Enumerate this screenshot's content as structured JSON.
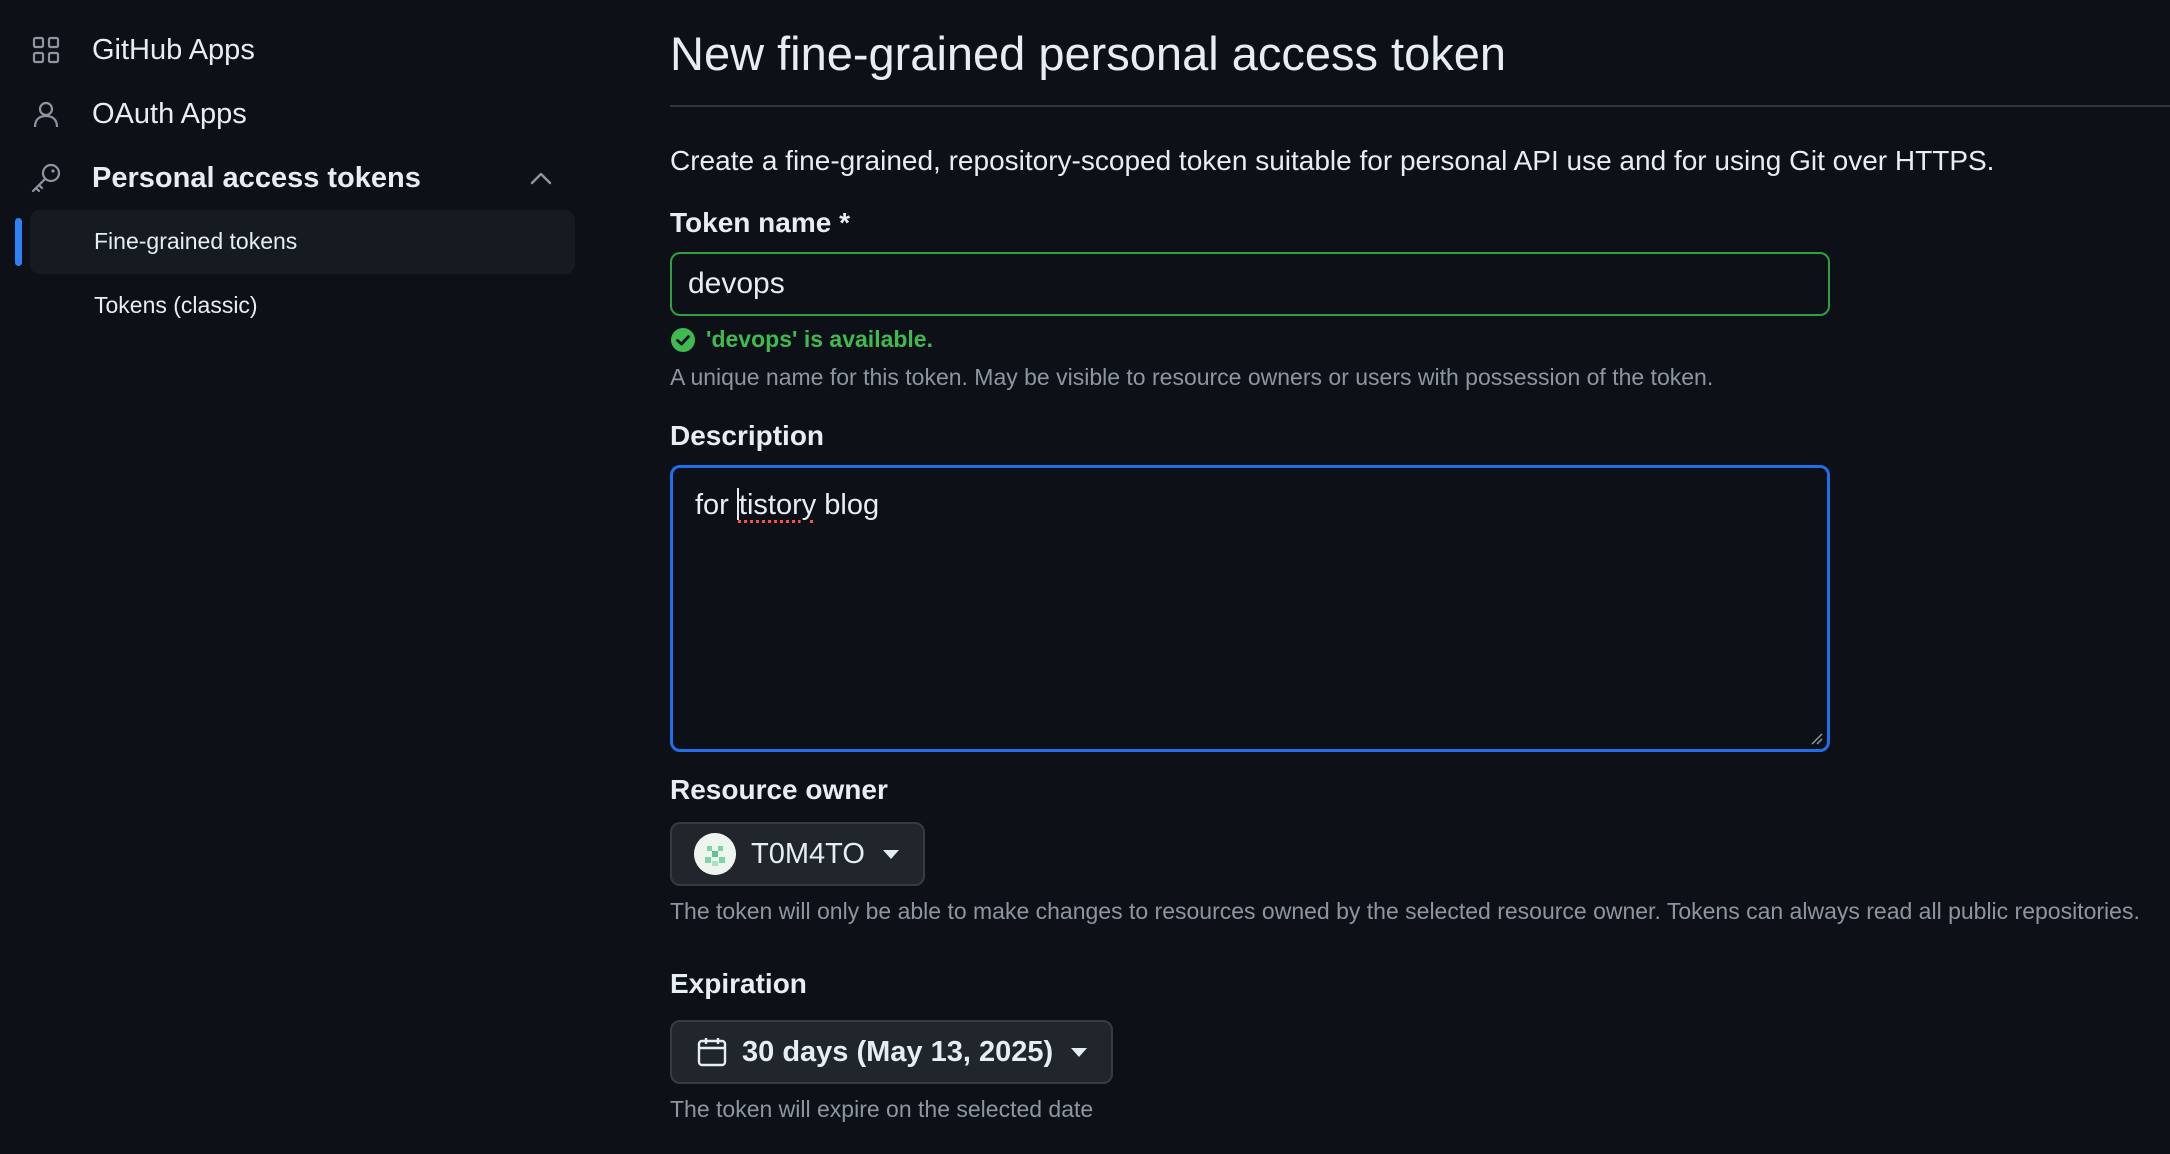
{
  "sidebar": {
    "items": [
      {
        "label": "GitHub Apps",
        "icon": "apps-grid-icon"
      },
      {
        "label": "OAuth Apps",
        "icon": "person-icon"
      },
      {
        "label": "Personal access tokens",
        "icon": "key-icon"
      }
    ],
    "sub_items": [
      {
        "label": "Fine-grained tokens",
        "active": true
      },
      {
        "label": "Tokens (classic)",
        "active": false
      }
    ]
  },
  "main": {
    "title": "New fine-grained personal access token",
    "intro": "Create a fine-grained, repository-scoped token suitable for personal API use and for using Git over HTTPS.",
    "token_name": {
      "label": "Token name *",
      "value": "devops",
      "availability": "'devops' is available.",
      "hint": "A unique name for this token. May be visible to resource owners or users with possession of the token."
    },
    "description": {
      "label": "Description",
      "value_prefix": "for ",
      "value_misspelled": "tistory",
      "value_suffix": " blog"
    },
    "resource_owner": {
      "label": "Resource owner",
      "selected": "T0M4TO",
      "hint": "The token will only be able to make changes to resources owned by the selected resource owner. Tokens can always read all public repositories."
    },
    "expiration": {
      "label": "Expiration",
      "selected": "30 days (May 13, 2025)",
      "hint": "The token will expire on the selected date"
    }
  },
  "colors": {
    "background": "#0d1117",
    "accent_blue": "#2f81f7",
    "success_green": "#3fb950",
    "muted_text": "#8d96a0"
  }
}
